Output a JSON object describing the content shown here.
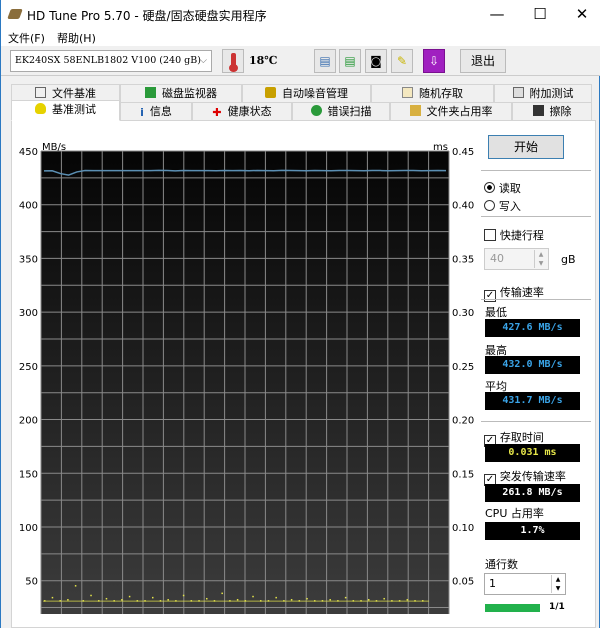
{
  "window": {
    "title": "HD Tune Pro 5.70 - 硬盘/固态硬盘实用程序",
    "minimize": "—",
    "maximize": "☐",
    "close": "✕"
  },
  "menu": [
    "文件(F)",
    "帮助(H)"
  ],
  "toolbar": {
    "drive": "EK240SX 58ENLB1802 V100 (240 gB)",
    "temperature": "18℃",
    "exit": "退出"
  },
  "tabs_top": [
    "文件基准",
    "磁盘监视器",
    "自动噪音管理",
    "随机存取",
    "附加测试"
  ],
  "tabs_bottom": [
    "基准测试",
    "信息",
    "健康状态",
    "错误扫描",
    "文件夹占用率",
    "擦除"
  ],
  "side": {
    "start": "开始",
    "read": "读取",
    "write": "写入",
    "quick": "快捷行程",
    "quick_value": "40",
    "quick_unit": "gB",
    "transfer_rate": "传输速率",
    "min_label": "最低",
    "min": "427.6 MB/s",
    "max_label": "最高",
    "max": "432.0 MB/s",
    "avg_label": "平均",
    "avg": "431.7 MB/s",
    "access_time": "存取时间",
    "access": "0.031 ms",
    "burst_rate": "突发传输速率",
    "burst": "261.8 MB/s",
    "cpu_label": "CPU 占用率",
    "cpu": "1.7%",
    "passes_label": "通行数",
    "passes": "1",
    "progress_text": "1/1",
    "progress": 1.0
  },
  "colors": {
    "read_line": "#5b8fb3",
    "access": "#e6e64a",
    "green": "#22b14c"
  },
  "chart_data": {
    "type": "line",
    "ylabel_left": "MB/s",
    "ylabel_right": "ms",
    "left_ticks": [
      "450",
      "400",
      "350",
      "300",
      "250",
      "200",
      "150",
      "100",
      "50"
    ],
    "right_ticks": [
      "0.45",
      "0.40",
      "0.35",
      "0.30",
      "0.25",
      "0.20",
      "0.15",
      "0.10",
      "0.05"
    ],
    "ylim": [
      19,
      450
    ],
    "y2lim": [
      0.019,
      0.45
    ],
    "series": [
      {
        "name": "transfer rate (MB/s)",
        "values": [
          431.5,
          431.6,
          429,
          427.6,
          430.5,
          431.8,
          431.7,
          431.7,
          431.7,
          431.7,
          431.7,
          431.7,
          431.7,
          431.7,
          432,
          431.8,
          431.5,
          431.8,
          431.7,
          431.7,
          431.7,
          431.6,
          431.9,
          431.7,
          431.8,
          431.6,
          431.9,
          431.7,
          431.6,
          432,
          431.8,
          431.7,
          431.6,
          431.9,
          431.7,
          431.6,
          431.8,
          431.9,
          431.7,
          431.6,
          431.9,
          431.8,
          431.6,
          431.7,
          431.9,
          431.8,
          431.6,
          431.7,
          431.8,
          431.7
        ]
      },
      {
        "name": "access time (ms)",
        "values": [
          0.031,
          0.034,
          0.031,
          0.032,
          0.045,
          0.031,
          0.036,
          0.031,
          0.033,
          0.031,
          0.032,
          0.035,
          0.031,
          0.031,
          0.034,
          0.031,
          0.032,
          0.031,
          0.036,
          0.031,
          0.031,
          0.033,
          0.031,
          0.038,
          0.031,
          0.032,
          0.031,
          0.035,
          0.031,
          0.031,
          0.034,
          0.031,
          0.032,
          0.031,
          0.033,
          0.031,
          0.031,
          0.032,
          0.031,
          0.034,
          0.031,
          0.031,
          0.032,
          0.031,
          0.033,
          0.031,
          0.031,
          0.032,
          0.031,
          0.031
        ]
      }
    ],
    "grid": true
  }
}
